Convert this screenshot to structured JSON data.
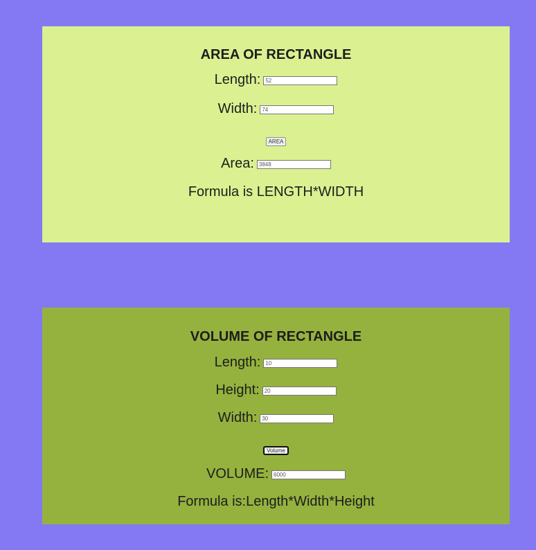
{
  "area_panel": {
    "title": "AREA OF RECTANGLE",
    "length_label": "Length:",
    "length_value": "52",
    "width_label": "Width:",
    "width_value": "74",
    "button_label": "AREA",
    "result_label": "Area:",
    "result_value": "3848",
    "formula": "Formula is LENGTH*WIDTH"
  },
  "volume_panel": {
    "title": "VOLUME OF RECTANGLE",
    "length_label": "Length:",
    "length_value": "10",
    "height_label": "Height:",
    "height_value": "20",
    "width_label": "Width:",
    "width_value": "30",
    "button_label": "Volume",
    "result_label": "VOLUME:",
    "result_value": "6000",
    "formula": "Formula is:Length*Width*Height"
  },
  "colors": {
    "page_background": "#8479f3",
    "area_panel_background": "#dbf191",
    "volume_panel_background": "#95b23e"
  }
}
